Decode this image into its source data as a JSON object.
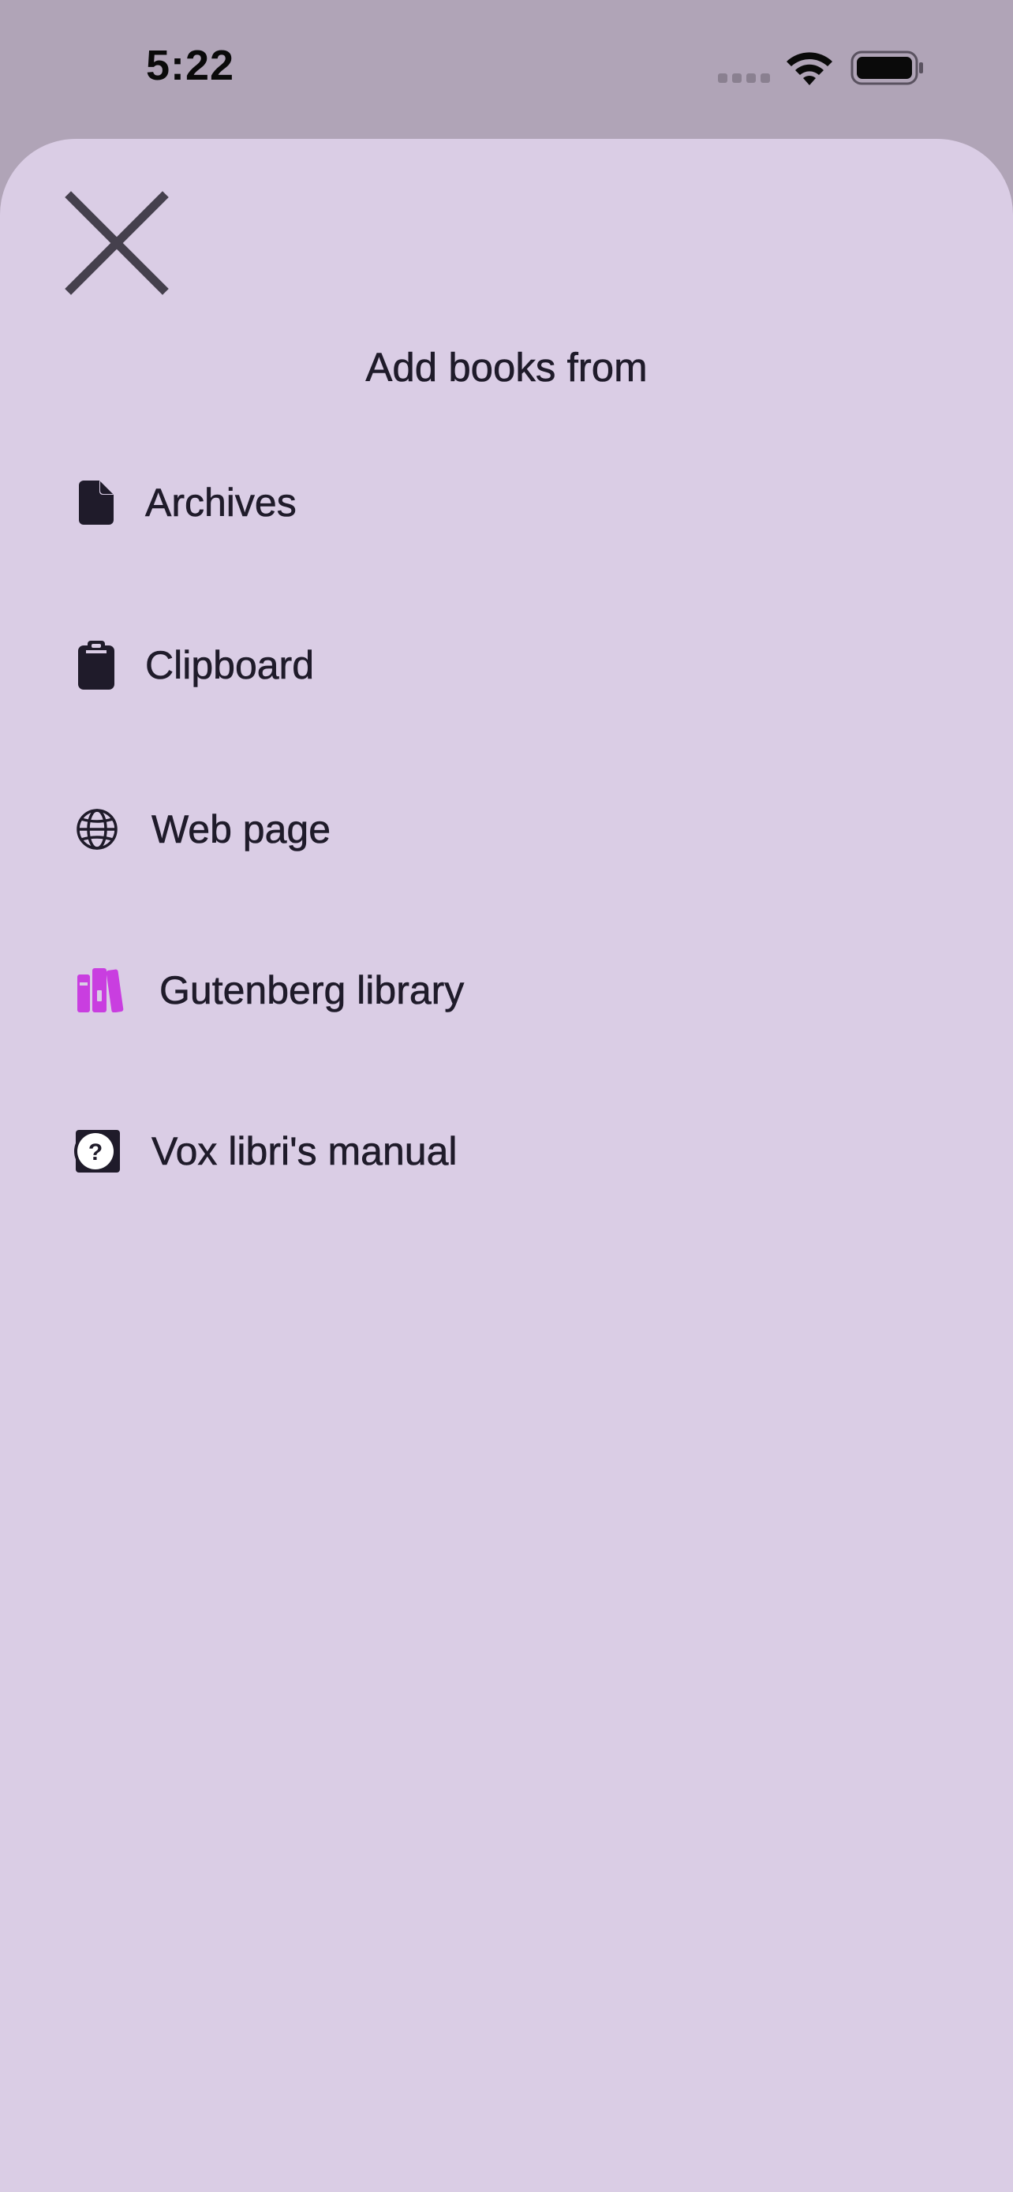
{
  "status_bar": {
    "time": "5:22"
  },
  "sheet": {
    "title": "Add books from",
    "close_icon": "close-icon",
    "items": [
      {
        "label": "Archives",
        "icon": "document-icon"
      },
      {
        "label": "Clipboard",
        "icon": "clipboard-icon"
      },
      {
        "label": "Web page",
        "icon": "globe-icon"
      },
      {
        "label": "Gutenberg library",
        "icon": "books-icon",
        "icon_color": "#c93ee0"
      },
      {
        "label": "Vox libri's manual",
        "icon": "help-icon"
      }
    ]
  },
  "colors": {
    "status_background": "#b0a4b7",
    "sheet_background": "#dacde5",
    "text": "#1f1b2a",
    "accent": "#c93ee0"
  }
}
